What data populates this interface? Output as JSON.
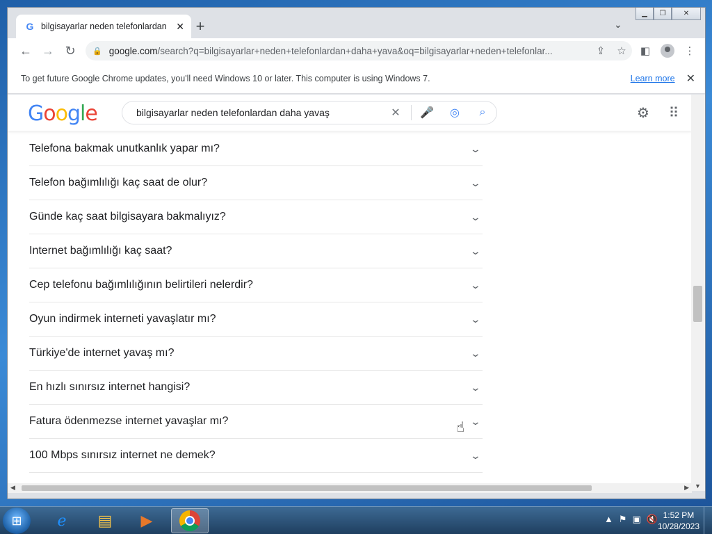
{
  "tab": {
    "title": "bilgisayarlar neden telefonlardan",
    "close": "✕",
    "favicon": "G",
    "new_tab": "+"
  },
  "toolbar": {
    "url_host": "google.com",
    "url_rest": "/search?q=bilgisayarlar+neden+telefonlardan+daha+yava&oq=bilgisayarlar+neden+telefonlar..."
  },
  "infobar": {
    "message": "To get future Google Chrome updates, you'll need Windows 10 or later. This computer is using Windows 7.",
    "learn_more": "Learn more",
    "close": "✕"
  },
  "google": {
    "logo_letters": [
      "G",
      "o",
      "o",
      "g",
      "l",
      "e"
    ],
    "query": "bilgisayarlar neden telefonlardan daha yavaş"
  },
  "questions": [
    "Telefona bakmak unutkanlık yapar mı?",
    "Telefon bağımlılığı kaç saat de olur?",
    "Günde kaç saat bilgisayara bakmalıyız?",
    "Internet bağımlılığı kaç saat?",
    "Cep telefonu bağımlılığının belirtileri nelerdir?",
    "Oyun indirmek interneti yavaşlatır mı?",
    "Türkiye'de internet yavaş mı?",
    "En hızlı sınırsız internet hangisi?",
    "Fatura ödenmezse internet yavaşlar mı?",
    "100 Mbps sınırsız internet ne demek?"
  ],
  "taskbar": {
    "time": "1:52 PM",
    "date": "10/28/2023"
  },
  "colors": {
    "link": "#1a73e8",
    "text": "#202124",
    "taskbar": "#2b5278"
  }
}
